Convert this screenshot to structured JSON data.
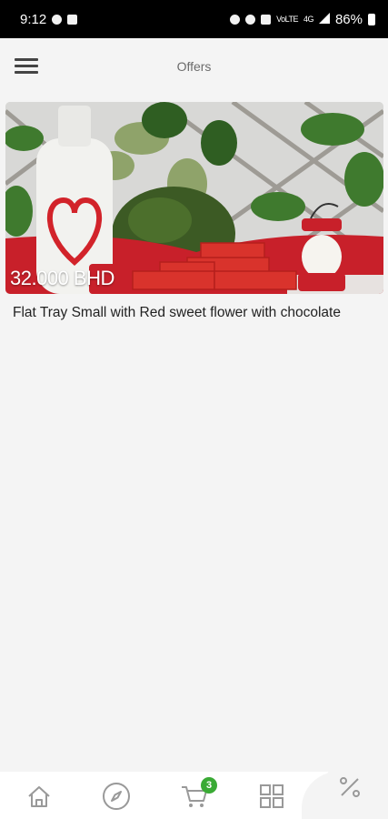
{
  "status_bar": {
    "time": "9:12",
    "net_label": "VoLTE",
    "net_gen": "4G",
    "battery": "86%"
  },
  "header": {
    "title": "Offers"
  },
  "offers": [
    {
      "price": "32.000 BHD",
      "title": "Flat Tray Small  with Red sweet flower with chocolate"
    }
  ],
  "bottom_nav": {
    "items": [
      "home-icon",
      "compass-icon",
      "cart-icon",
      "grid-icon"
    ],
    "cart_count": "3",
    "fab_icon": "percent-icon"
  },
  "colors": {
    "accent": "#3aaa35",
    "background": "#f4f4f4",
    "icon": "#999999"
  }
}
